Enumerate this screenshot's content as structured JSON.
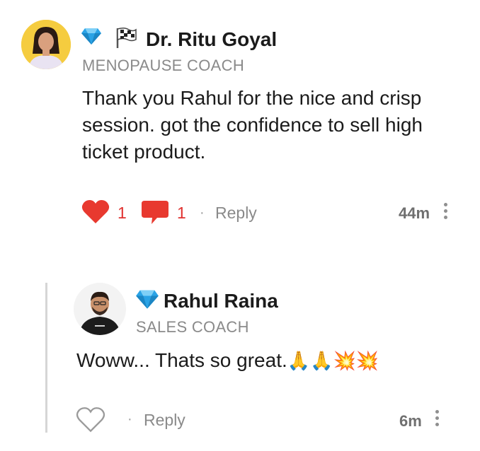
{
  "comment": {
    "author": "Dr. Ritu Goyal",
    "role": "MENOPAUSE COACH",
    "text": "Thank you Rahul for the nice and crisp session. got the confidence to sell high ticket product.",
    "likes": "1",
    "replies_count": "1",
    "dot": "·",
    "reply_label": "Reply",
    "time": "44m",
    "badges": [
      "diamond-icon",
      "checkered-flag-icon"
    ],
    "colors": {
      "heart": "#e8392f",
      "bubble": "#e8392f"
    }
  },
  "reply": {
    "author": "Rahul Raina",
    "role": "SALES COACH",
    "text": "Woww... Thats so great.",
    "emoji": "🙏🙏💥💥",
    "dot": "·",
    "reply_label": "Reply",
    "time": "6m",
    "badges": [
      "diamond-icon"
    ]
  }
}
